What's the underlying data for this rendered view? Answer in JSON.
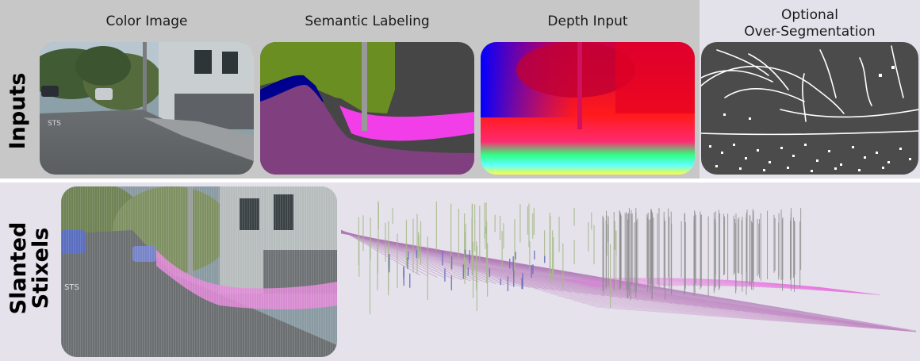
{
  "rows": {
    "inputs": "Inputs",
    "stixels_line1": "Slanted",
    "stixels_line2": "Stixels"
  },
  "columns": {
    "color": "Color Image",
    "semantic": "Semantic Labeling",
    "depth": "Depth Input",
    "overseg_line1": "Optional",
    "overseg_line2": "Over-Segmentation"
  },
  "colors": {
    "road": "#80407f",
    "sidewalk": "#f23ee8",
    "vegetation": "#6b8e23",
    "building": "#464646",
    "car": "#00008e",
    "sky": "#4682b4"
  }
}
